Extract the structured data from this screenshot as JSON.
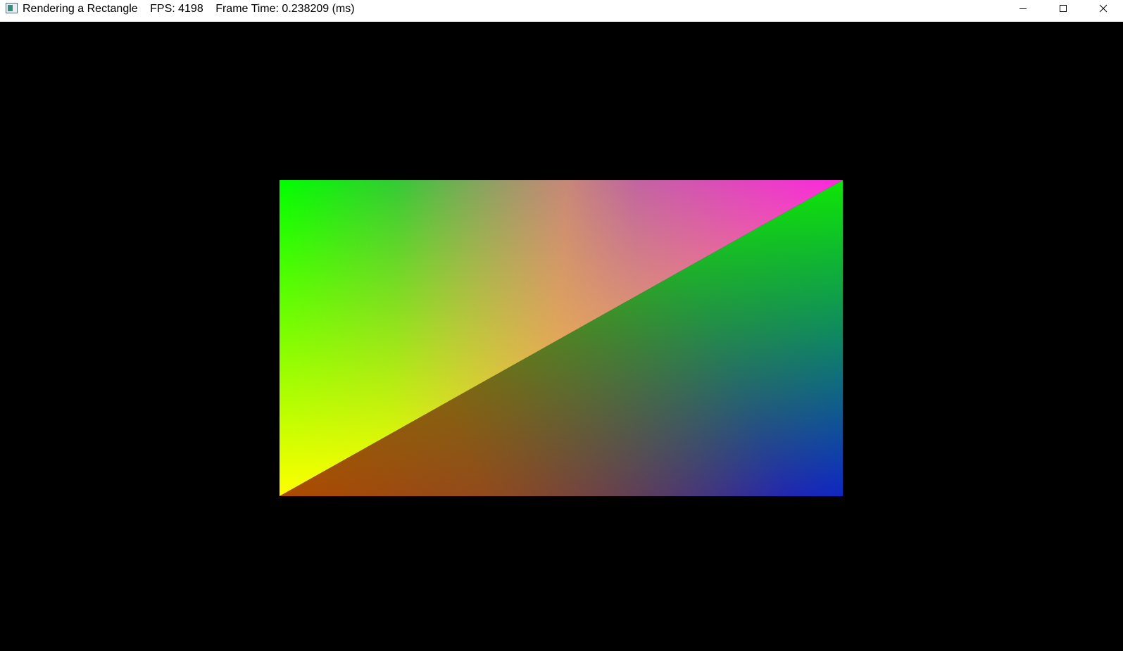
{
  "window": {
    "title": "Rendering a Rectangle",
    "fps_text": "FPS: 4198",
    "frame_time_text": "Frame Time: 0.238209 (ms)",
    "controls": {
      "minimize": "minimize-icon",
      "maximize": "maximize-icon",
      "close": "close-icon"
    }
  },
  "scene": {
    "background_color": "#000000",
    "upper_left_triangle": {
      "vertex_colors": {
        "top_left": "#00ff00",
        "top_right": "#ff00ff",
        "bottom_left": "#ffff00"
      }
    },
    "lower_right_triangle": {
      "vertex_colors": {
        "top_right": "#00ff00",
        "bottom_right": "#0000ff",
        "bottom_left": "#ff0000"
      }
    }
  }
}
